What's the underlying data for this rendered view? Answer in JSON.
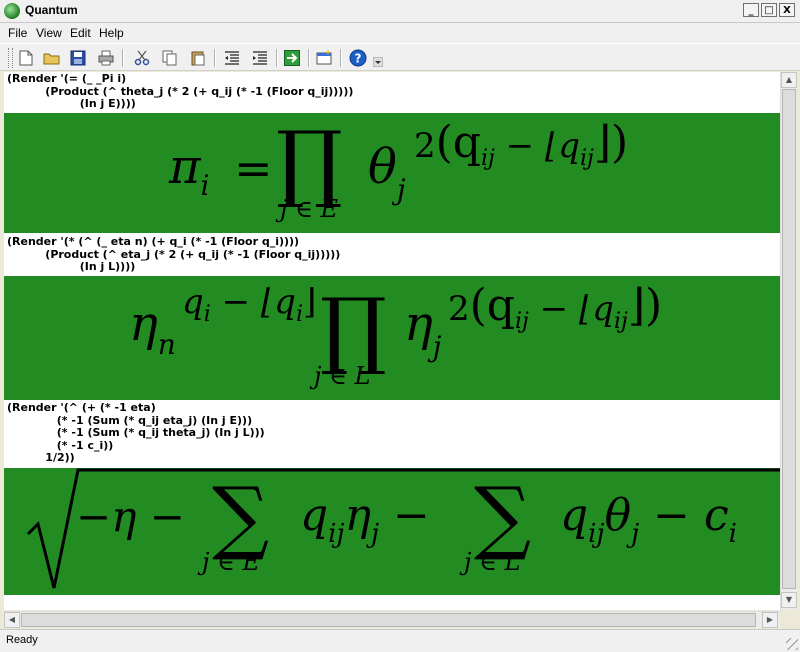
{
  "window": {
    "title": "Quantum"
  },
  "titlebar_buttons": {
    "minimize": "_",
    "maximize": "□",
    "close": "X"
  },
  "menu": {
    "items": [
      "File",
      "View",
      "Edit",
      "Help"
    ]
  },
  "toolbar": {
    "icons": [
      "new-file-icon",
      "open-folder-icon",
      "save-icon",
      "print-icon",
      "cut-icon",
      "copy-icon",
      "paste-icon",
      "indent-less-icon",
      "indent-more-icon",
      "run-icon",
      "new-window-icon",
      "help-icon"
    ]
  },
  "blocks": [
    {
      "code": "(Render '(= (_ _Pi i)\n          (Product (^ theta_j (* 2 (+ q_ij (* -1 (Floor q_ij)))))\n                   (In j E))))",
      "formula": {
        "lhs": "π",
        "lhs_sub": "i",
        "eq": "=",
        "big_op": "∏",
        "big_op_sub": "j ∈ E",
        "base": "θ",
        "base_sub": "j",
        "sup_main": "2",
        "sup_paren": "(q",
        "sup_q_sub": "ij",
        "sup_minus": " − ⌊q",
        "sup_q_sub2": "ij",
        "sup_close": "⌋)"
      }
    },
    {
      "code": "(Render '(* (^ (_ eta n) (+ q_i (* -1 (Floor q_i))))\n          (Product (^ eta_j (* 2 (+ q_ij (* -1 (Floor q_ij)))))\n                   (In j L))))",
      "formula": {
        "eta": "η",
        "eta_sub": "n",
        "exp_q": "q",
        "exp_q_sub": "i",
        "exp_minus": " − ⌊q",
        "exp_q_sub2": "i",
        "exp_close": "⌋",
        "big_op": "∏",
        "big_op_sub": "j ∈ L",
        "base": "η",
        "base_sub": "j",
        "sup_main": "2",
        "sup_paren": "(q",
        "sup_q_sub": "ij",
        "sup_minus": " − ⌊q",
        "sup_q_sub2": "ij",
        "sup_close": "⌋)"
      }
    },
    {
      "code": "(Render '(^ (+ (* -1 eta)\n             (* -1 (Sum (* q_ij eta_j) (In j E)))\n             (* -1 (Sum (* q_ij theta_j) (In j L)))\n             (* -1 c_i))\n          1/2))",
      "formula": {
        "t1": "−η − ",
        "sum1": "∑",
        "sum1_sub": "j ∈ E",
        "t2_q": "q",
        "t2_q_sub": "ij",
        "t2_v": "η",
        "t2_v_sub": "j",
        "minus2": " − ",
        "sum2": "∑",
        "sum2_sub": "j ∈ L",
        "t3_q": "q",
        "t3_q_sub": "ij",
        "t3_v": "θ",
        "t3_v_sub": "j",
        "t4": " − c",
        "t4_sub": "i"
      }
    }
  ],
  "status": {
    "text": "Ready"
  },
  "colors": {
    "formula_bg": "#228b22",
    "chrome": "#f0f0f0"
  }
}
